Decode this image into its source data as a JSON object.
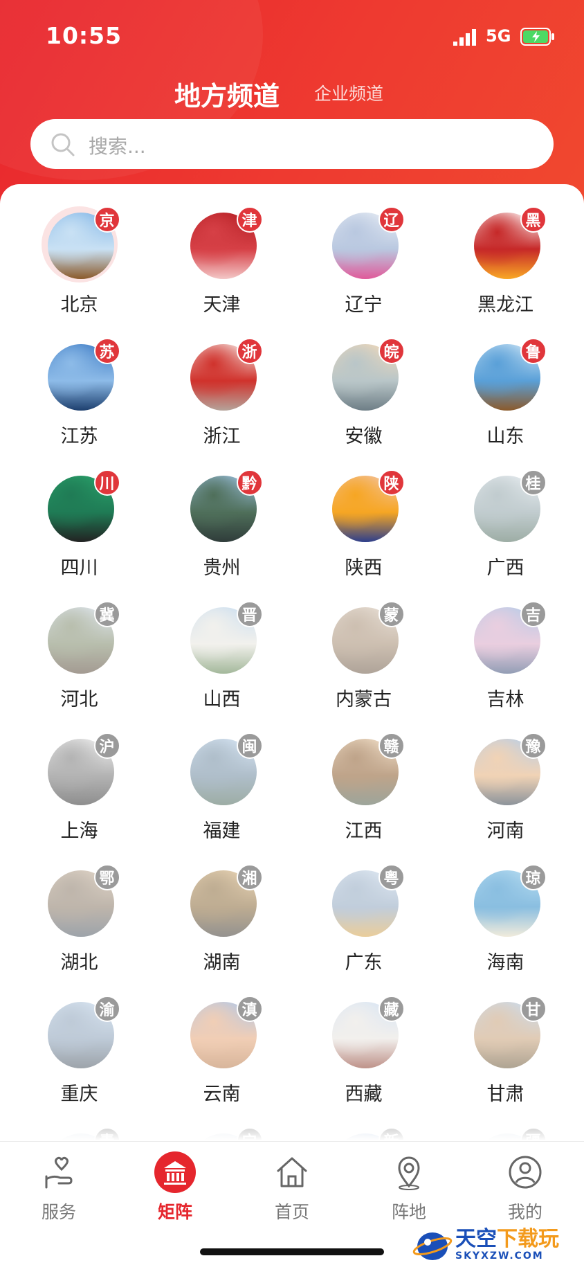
{
  "status_bar": {
    "time": "10:55",
    "network": "5G"
  },
  "channel_tabs": {
    "active": "地方频道",
    "inactive": "企业频道"
  },
  "search": {
    "placeholder": "搜索..."
  },
  "regions": [
    {
      "name": "北京",
      "badge": "京",
      "active": true,
      "palette": [
        "#7fb4e6",
        "#c9e1f4",
        "#8b5a2b"
      ]
    },
    {
      "name": "天津",
      "badge": "津",
      "active": true,
      "palette": [
        "#b31d22",
        "#d64046",
        "#f3c7c7"
      ]
    },
    {
      "name": "辽宁",
      "badge": "辽",
      "active": true,
      "palette": [
        "#e9eef5",
        "#b9c8e0",
        "#e05a9a"
      ]
    },
    {
      "name": "黑龙江",
      "badge": "黑",
      "active": true,
      "palette": [
        "#ffffff",
        "#c62828",
        "#f9a825"
      ]
    },
    {
      "name": "江苏",
      "badge": "苏",
      "active": true,
      "palette": [
        "#3a78c2",
        "#8dbbe8",
        "#1d3f6e"
      ]
    },
    {
      "name": "浙江",
      "badge": "浙",
      "active": true,
      "palette": [
        "#f6eeea",
        "#d0322c",
        "#b5a39a"
      ]
    },
    {
      "name": "安徽",
      "badge": "皖",
      "active": true,
      "palette": [
        "#f4d9b8",
        "#b9c6c8",
        "#6e7e86"
      ]
    },
    {
      "name": "山东",
      "badge": "鲁",
      "active": true,
      "palette": [
        "#cfe6f6",
        "#5aa0d8",
        "#8b5a2b"
      ]
    },
    {
      "name": "四川",
      "badge": "川",
      "active": true,
      "palette": [
        "#2aa36b",
        "#1f7b55",
        "#222222"
      ]
    },
    {
      "name": "贵州",
      "badge": "黔",
      "active": true,
      "palette": [
        "#9ec3e4",
        "#4f6f5a",
        "#2f3c3a"
      ]
    },
    {
      "name": "陕西",
      "badge": "陕",
      "active": true,
      "palette": [
        "#f3c4a8",
        "#f6a623",
        "#2d3e8c"
      ]
    },
    {
      "name": "广西",
      "badge": "桂",
      "active": false,
      "palette": [
        "#d6dfe6",
        "#8fa3a8",
        "#4e6b5c"
      ]
    },
    {
      "name": "河北",
      "badge": "冀",
      "active": false,
      "palette": [
        "#c7d4e4",
        "#7f8a6b",
        "#5a4a3a"
      ]
    },
    {
      "name": "山西",
      "badge": "晋",
      "active": false,
      "palette": [
        "#9ec3e4",
        "#e8e6df",
        "#5a7f4a"
      ]
    },
    {
      "name": "内蒙古",
      "badge": "蒙",
      "active": false,
      "palette": [
        "#d7c7b6",
        "#a58c72",
        "#6e5a47"
      ]
    },
    {
      "name": "吉林",
      "badge": "吉",
      "active": false,
      "palette": [
        "#7aa4d6",
        "#d9a7c6",
        "#3b4f7a"
      ]
    },
    {
      "name": "上海",
      "badge": "沪",
      "active": false,
      "palette": [
        "#e8e8e8",
        "#777777",
        "#333333"
      ]
    },
    {
      "name": "福建",
      "badge": "闽",
      "active": false,
      "palette": [
        "#b8d3ee",
        "#6f8aa0",
        "#4e6b5c"
      ]
    },
    {
      "name": "江西",
      "badge": "赣",
      "active": false,
      "palette": [
        "#e9c9a0",
        "#8b5a2b",
        "#4e5c4a"
      ]
    },
    {
      "name": "河南",
      "badge": "豫",
      "active": false,
      "palette": [
        "#7da7d8",
        "#e6b07a",
        "#2f3c4a"
      ]
    },
    {
      "name": "湖北",
      "badge": "鄂",
      "active": false,
      "palette": [
        "#c9b49c",
        "#8a7a68",
        "#4f5a66"
      ]
    },
    {
      "name": "湖南",
      "badge": "湘",
      "active": false,
      "palette": [
        "#d9b37a",
        "#8a6a3a",
        "#3e3a34"
      ]
    },
    {
      "name": "广东",
      "badge": "粤",
      "active": false,
      "palette": [
        "#c7d8ea",
        "#8fa6bf",
        "#d9a54a"
      ]
    },
    {
      "name": "海南",
      "badge": "琼",
      "active": false,
      "palette": [
        "#7fc3e8",
        "#2b8ac8",
        "#e6dcc0"
      ]
    },
    {
      "name": "重庆",
      "badge": "渝",
      "active": false,
      "palette": [
        "#bcd3ea",
        "#8aa0b8",
        "#4e5a66"
      ]
    },
    {
      "name": "云南",
      "badge": "滇",
      "active": false,
      "palette": [
        "#6f9ad8",
        "#e6a77a",
        "#b97a4a"
      ]
    },
    {
      "name": "西藏",
      "badge": "藏",
      "active": false,
      "palette": [
        "#b7d0ec",
        "#e8e4df",
        "#8a3a2a"
      ]
    },
    {
      "name": "甘肃",
      "badge": "甘",
      "active": false,
      "palette": [
        "#9fc0e2",
        "#c9a27a",
        "#6e5a3a"
      ]
    },
    {
      "name": "",
      "badge": "青",
      "active": false,
      "palette": [
        "#b7d0ec",
        "#e8e4df",
        "#8a9aa6"
      ]
    },
    {
      "name": "",
      "badge": "宁",
      "active": false,
      "palette": [
        "#b7d0ec",
        "#e8e4df",
        "#8a9aa6"
      ]
    },
    {
      "name": "",
      "badge": "新",
      "active": false,
      "palette": [
        "#6f9ad8",
        "#e8e4df",
        "#8a9aa6"
      ]
    },
    {
      "name": "",
      "badge": "疆",
      "active": false,
      "palette": [
        "#b7d0ec",
        "#e8e4df",
        "#8a9aa6"
      ]
    }
  ],
  "tabbar": {
    "items": [
      {
        "label": "服务",
        "icon": "hand-heart-icon",
        "active": false
      },
      {
        "label": "矩阵",
        "icon": "institution-icon",
        "active": true
      },
      {
        "label": "首页",
        "icon": "home-icon",
        "active": false
      },
      {
        "label": "阵地",
        "icon": "location-pin-icon",
        "active": false
      },
      {
        "label": "我的",
        "icon": "profile-icon",
        "active": false
      }
    ]
  },
  "watermark": {
    "main_a": "天空",
    "main_b": "下载玩",
    "sub": "SKYXZW.COM"
  },
  "colors": {
    "brand_red": "#e5262d",
    "badge_red": "#e0363b",
    "badge_grey": "#9a9a9a"
  }
}
